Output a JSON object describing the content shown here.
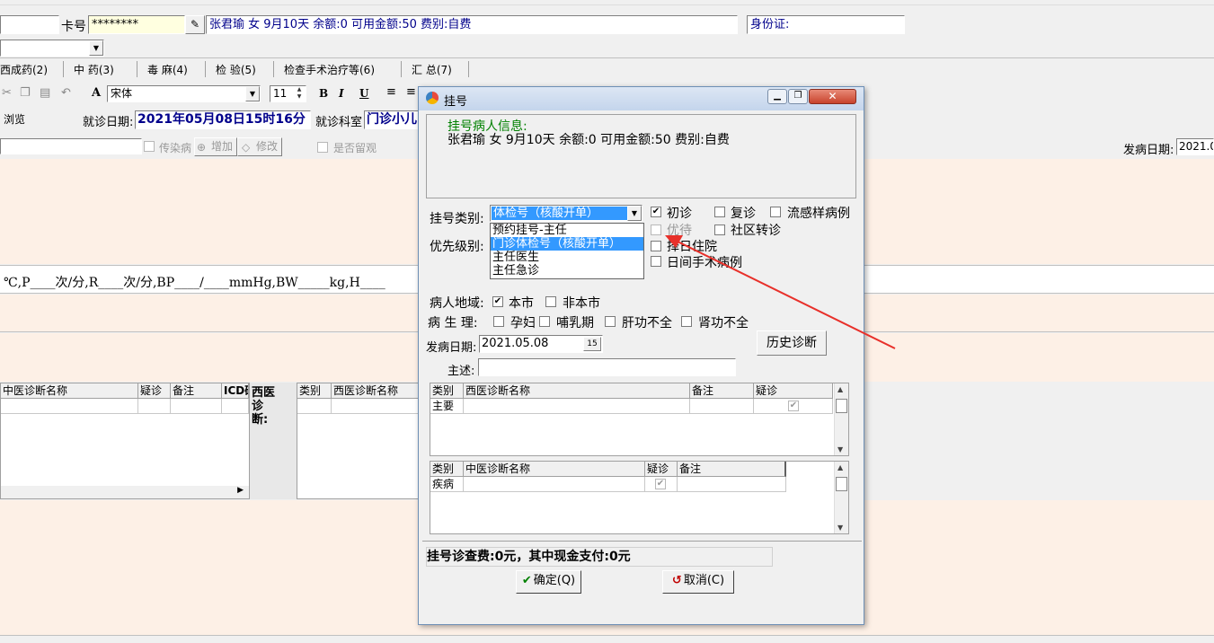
{
  "top": {
    "card_label": "卡号",
    "card_value": "********",
    "patient_summary": "张君瑜 女 9月10天 余额:0 可用金额:50 费别:自费",
    "id_label": "身份证:"
  },
  "tabs": [
    "西成药(2)",
    "中 药(3)",
    "毒 麻(4)",
    "检 验(5)",
    "检查手术治疗等(6)",
    "汇 总(7)"
  ],
  "toolbar": {
    "font_name": "宋体",
    "font_size": "11",
    "bold": "B",
    "italic": "I",
    "underline": "U"
  },
  "visit": {
    "browse": "浏览",
    "date_label": "就诊日期:",
    "date_value": "2021年05月08日15时16分",
    "dept_label": "就诊科室",
    "dept_value": "门诊小儿"
  },
  "bg_row": {
    "infectious": "传染病",
    "add": "增加",
    "edit": "修改",
    "observe": "是否留观",
    "onset_label": "发病日期:",
    "onset_value": "2021.0"
  },
  "vitals": "℃,P____次/分,R____次/分,BP____/____mmHg,BW_____kg,H____",
  "bg_grid_cols": [
    "中医诊断名称",
    "疑诊",
    "备注",
    "ICD码"
  ],
  "bg_west_label": "西医诊断:",
  "bg_grid2_cols": [
    "类别",
    "西医诊断名称"
  ],
  "dialog": {
    "title": "挂号",
    "info_title": "挂号病人信息:",
    "info_text": "张君瑜 女 9月10天 余额:0 可用金额:50 费别:自费",
    "reg_type_label": "挂号类别:",
    "reg_type_value": "体检号（核酸开单）",
    "dropdown_options": [
      "预约挂号-主任",
      "门诊体检号（核酸开单）",
      "主任医生",
      "主任急诊"
    ],
    "priority_label": "优先级别:",
    "first_visit": "初诊",
    "return_visit": "复诊",
    "flu_case": "流感样病例",
    "priority_wait": "优待",
    "community": "社区转诊",
    "next_day": "择日住院",
    "day_surgery": "日间手术病例",
    "region_label": "病人地域:",
    "local": "本市",
    "nonlocal": "非本市",
    "physio_label": "病 生 理:",
    "pregnant": "孕妇",
    "lactation": "哺乳期",
    "liver": "肝功不全",
    "kidney": "肾功不全",
    "onset_label": "发病日期:",
    "onset_value": "2021.05.08",
    "calendar_icon": "15",
    "history_btn": "历史诊断",
    "complaint_label": "主述:",
    "west_cols": [
      "类别",
      "西医诊断名称",
      "备注",
      "疑诊"
    ],
    "west_row": "主要",
    "tcm_cols": [
      "类别",
      "中医诊断名称",
      "疑诊",
      "备注"
    ],
    "tcm_row": "疾病",
    "fee_text": "挂号诊查费:0元，其中现金支付:0元",
    "ok_btn": "确定(Q)",
    "cancel_btn": "取消(C)"
  }
}
